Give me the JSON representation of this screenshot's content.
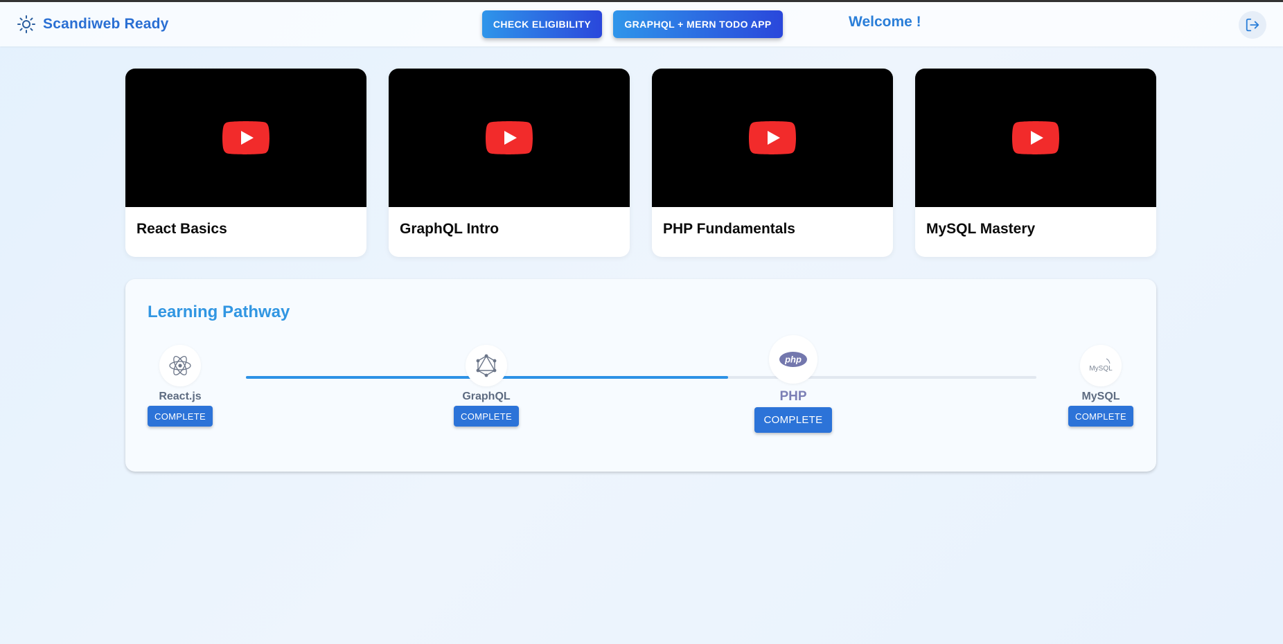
{
  "header": {
    "brand": "Scandiweb Ready",
    "check_eligibility": "CHECK ELIGIBILITY",
    "todo_app": "GRAPHQL + MERN TODO APP",
    "welcome": "Welcome !"
  },
  "videos": [
    {
      "title": "React Basics"
    },
    {
      "title": "GraphQL Intro"
    },
    {
      "title": "PHP Fundamentals"
    },
    {
      "title": "MySQL Mastery"
    }
  ],
  "pathway": {
    "title": "Learning Pathway",
    "progress_fraction": 0.61,
    "steps": [
      {
        "label": "React.js",
        "status": "COMPLETE",
        "icon": "react-icon"
      },
      {
        "label": "GraphQL",
        "status": "COMPLETE",
        "icon": "graphql-icon"
      },
      {
        "label": "PHP",
        "status": "COMPLETE",
        "icon": "php-icon"
      },
      {
        "label": "MySQL",
        "status": "COMPLETE",
        "icon": "mysql-icon",
        "icon_text": "MySQL"
      }
    ]
  },
  "colors": {
    "accent": "#2a6fd3",
    "button_gradient_start": "#2f95ea",
    "button_gradient_end": "#2a47db",
    "progress": "#2d92e6",
    "youtube_red": "#f22b2b"
  }
}
